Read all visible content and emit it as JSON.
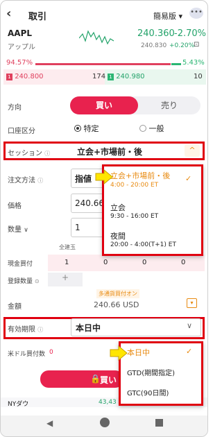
{
  "header": {
    "back_icon": "back-arrow",
    "title": "取引",
    "mode": "簡易版 ▾",
    "more_icon": "more-dots"
  },
  "quote": {
    "symbol": "AAPL",
    "name": "アップル",
    "price": "240.360",
    "change": "-2.70%",
    "prev": "240.830",
    "after": "+0.20%"
  },
  "depth": {
    "bid_pct": "94.57%",
    "ask_pct": "5.43%",
    "bid_price": "240.800",
    "bid_size": "174",
    "ask_price": "240.980",
    "ask_size": "10"
  },
  "order": {
    "direction_label": "方向",
    "buy": "買い",
    "sell": "売り",
    "account_label": "口座区分",
    "account_opt1": "特定",
    "account_opt2": "一般",
    "session_label": "セッション",
    "session_value": "立会+市場前・後",
    "order_type_label": "注文方法",
    "order_type_value": "指値",
    "price_label": "価格",
    "price_value": "240.66",
    "qty_label": "数量",
    "qty_value": "1",
    "qty_headers": [
      "全建玉"
    ],
    "cash_label": "現金買付",
    "cash_values": [
      "1",
      "0",
      "0",
      "0"
    ],
    "reg_label": "登録数量",
    "reg_plus": "+",
    "promo": "多通貨買付オン",
    "amount_label": "金額",
    "amount_value": "240.66 USD",
    "expiry_label": "有効期限",
    "expiry_value": "本日中",
    "usd_label": "米ドル買付数",
    "usd_value": "0",
    "submit": "買い"
  },
  "session_dropdown": [
    {
      "title": "立会+市場前・後",
      "sub": "4:00 - 20:00 ET",
      "selected": true
    },
    {
      "title": "立会",
      "sub": "9:30 - 16:00 ET",
      "selected": false
    },
    {
      "title": "夜間",
      "sub": "20:00 - 4:00(T+1) ET",
      "selected": false
    }
  ],
  "expiry_dropdown": [
    {
      "title": "本日中",
      "selected": true
    },
    {
      "title": "GTD(期間指定)",
      "selected": false
    },
    {
      "title": "GTC(90日間)",
      "selected": false
    }
  ],
  "ticker": {
    "name": "NYダウ",
    "value": "43,43"
  },
  "colors": {
    "red": "#e8224e",
    "green": "#23a36a",
    "highlight": "#e00010",
    "orange": "#e88a10",
    "arrow": "#ffe600"
  }
}
